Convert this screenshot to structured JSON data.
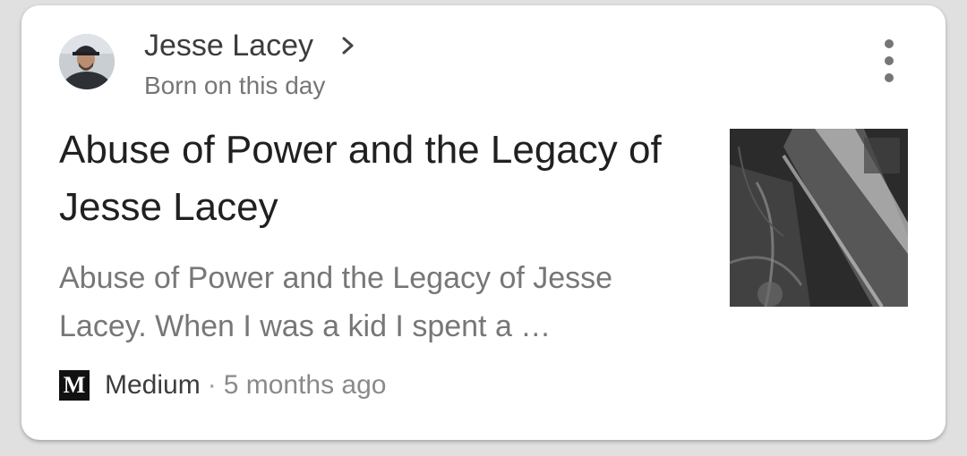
{
  "header": {
    "name": "Jesse Lacey",
    "subtitle": "Born on this day"
  },
  "article": {
    "headline": "Abuse of Power and the Legacy of Jesse Lacey",
    "snippet": "Abuse of Power and the Legacy of Jesse Lacey. When I was a kid I spent a …",
    "source": {
      "logo_letter": "M",
      "name": "Medium",
      "separator": "·",
      "time": "5 months ago"
    }
  },
  "icons": {
    "chevron": "chevron-right-icon",
    "more": "more-vert-icon"
  }
}
